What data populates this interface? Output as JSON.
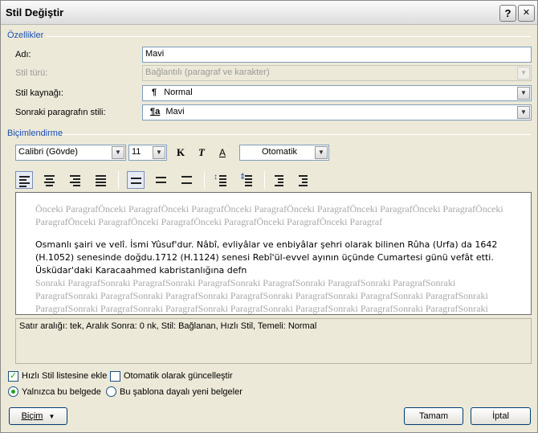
{
  "dialog": {
    "title": "Stil Değiştir",
    "help_glyph": "?",
    "close_glyph": "✕"
  },
  "properties": {
    "section_label": "Özellikler",
    "name_label": "Adı:",
    "name_value": "Mavi",
    "type_label": "Stil türü:",
    "type_value": "Bağlantılı (paragraf ve karakter)",
    "based_on_label": "Stil kaynağı:",
    "based_on_value": "Normal",
    "based_on_icon": "¶",
    "next_label": "Sonraki paragrafın stili:",
    "next_value": "Mavi",
    "next_icon": "¶a"
  },
  "formatting": {
    "section_label": "Biçimlendirme",
    "font_name": "Calibri (Gövde)",
    "font_size": "11",
    "bold_glyph": "K",
    "italic_glyph": "T",
    "underline_glyph": "A",
    "color_value": "Otomatik"
  },
  "preview": {
    "prev_line_1": "Önceki ParagrafÖnceki ParagrafÖnceki ParagrafÖnceki ParagrafÖnceki ParagrafÖnceki ParagrafÖnceki ParagrafÖnceki",
    "prev_line_2": "ParagrafÖnceki ParagrafÖnceki ParagrafÖnceki ParagrafÖnceki ParagrafÖnceki Paragraf",
    "main_line_1": "Osmanlı şairi ve velî. İsmi Yûsuf'dur. Nâbî, evliyâlar ve enbiyâlar şehri olarak bilinen Rûha (Urfa) da 1642",
    "main_line_2": "(H.1052) senesinde doğdu.1712 (H.1124) senesi Rebî'ül-evvel ayının üçünde Cumartesi günü vefât etti.",
    "main_line_3": "Üsküdar'daki Karacaahmed kabristanlığına defn",
    "next_line_1": "Sonraki ParagrafSonraki ParagrafSonraki ParagrafSonraki ParagrafSonraki ParagrafSonraki ParagrafSonraki",
    "next_line_2": "ParagrafSonraki ParagrafSonraki ParagrafSonraki ParagrafSonraki ParagrafSonraki ParagrafSonraki ParagrafSonraki",
    "next_line_3": "ParagrafSonraki ParagrafSonraki ParagrafSonraki ParagrafSonraki ParagrafSonraki ParagrafSonraki ParagrafSonraki"
  },
  "description": "Satır aralığı:  tek, Aralık Sonra:  0 nk, Stil: Bağlanan, Hızlı Stil, Temeli: Normal",
  "options": {
    "quick_style_label": "Hızlı Stil listesine ekle",
    "quick_style_checked": true,
    "auto_update_label": "Otomatik olarak güncelleştir",
    "auto_update_checked": false,
    "this_doc_label": "Yalnızca bu belgede",
    "new_docs_label": "Bu şablona dayalı yeni belgeler"
  },
  "buttons": {
    "format_label": "Biçim",
    "ok_label": "Tamam",
    "cancel_label": "İptal"
  },
  "colors": {
    "section_label": "#1d4fb5",
    "check_mark": "#21a121",
    "preview_gray": "#a8a8a8"
  }
}
